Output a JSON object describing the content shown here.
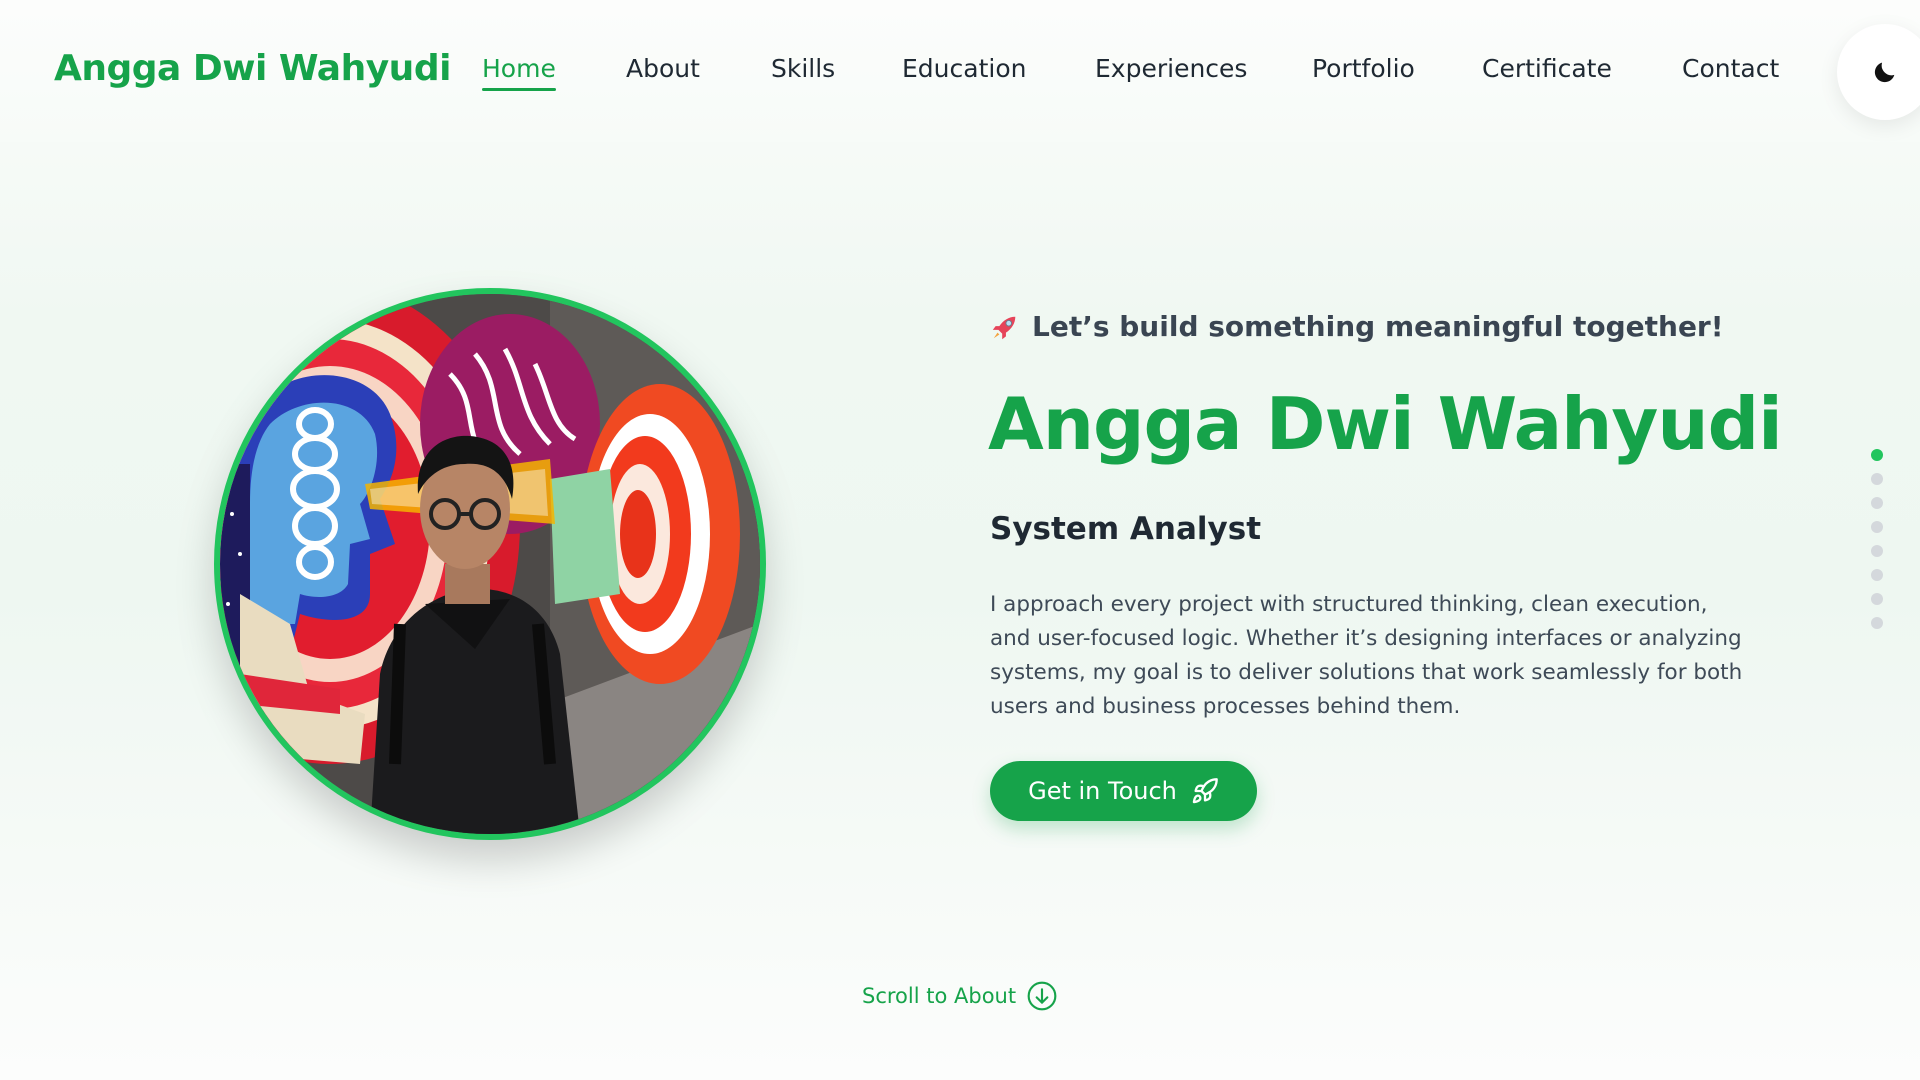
{
  "header": {
    "brand": "Angga Dwi Wahyudi",
    "nav": [
      {
        "label": "Home",
        "active": true
      },
      {
        "label": "About",
        "active": false
      },
      {
        "label": "Skills",
        "active": false
      },
      {
        "label": "Education",
        "active": false
      },
      {
        "label": "Experiences",
        "active": false
      },
      {
        "label": "Portfolio",
        "active": false
      },
      {
        "label": "Certificate",
        "active": false
      },
      {
        "label": "Contact",
        "active": false
      }
    ],
    "theme_toggle_icon": "moon-icon"
  },
  "hero": {
    "tagline_icon": "rocket-icon",
    "tagline": "Let’s build something meaningful together!",
    "name": "Angga Dwi Wahyudi",
    "role": "System Analyst",
    "description": "I approach every project with structured thinking, clean execution, and user-focused logic. Whether it’s designing interfaces or analyzing systems, my goal is to deliver solutions that work seamlessly for both users and business processes behind them.",
    "cta_label": "Get in Touch",
    "cta_icon": "rocket-icon"
  },
  "section_dots": {
    "count": 8,
    "active_index": 0
  },
  "scroll": {
    "label": "Scroll to About",
    "icon": "arrow-down-circle-icon"
  },
  "colors": {
    "accent": "#16a34a",
    "accent_light": "#22c55e",
    "text": "#1f2933"
  }
}
